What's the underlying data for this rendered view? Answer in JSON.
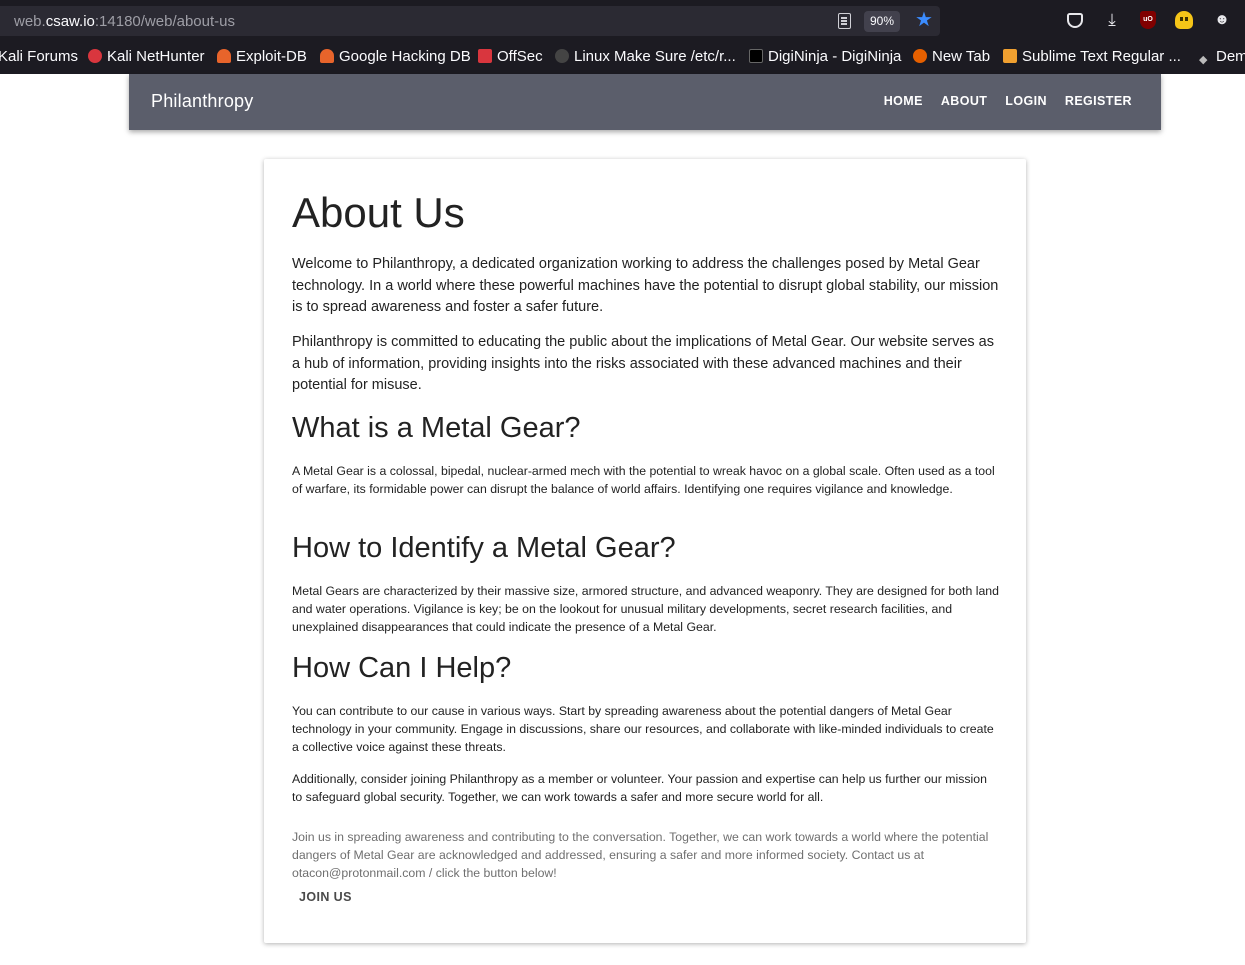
{
  "browser": {
    "url_prefix": "web.",
    "url_host": "csaw.io",
    "url_path": ":14180/web/about-us",
    "zoom": "90%",
    "bookmarks": [
      {
        "label": "Kali Forums",
        "color": "#2f6fd1"
      },
      {
        "label": "Kali NetHunter",
        "color": "#d9363e"
      },
      {
        "label": "Exploit-DB",
        "color": "#e8642b"
      },
      {
        "label": "Google Hacking DB",
        "color": "#e8642b"
      },
      {
        "label": "OffSec",
        "color": "#d9363e"
      },
      {
        "label": "Linux Make Sure /etc/r...",
        "color": "#444444"
      },
      {
        "label": "DigiNinja - DigiNinja",
        "color": "#000000"
      },
      {
        "label": "New Tab",
        "color": "#e66000"
      },
      {
        "label": "Sublime Text Regular ...",
        "color": "#f0a030"
      },
      {
        "label": "Dem",
        "color": "#bbbbbb"
      }
    ]
  },
  "navbar": {
    "brand": "Philanthropy",
    "links": [
      "HOME",
      "ABOUT",
      "LOGIN",
      "REGISTER"
    ]
  },
  "content": {
    "title": "About Us",
    "intro1": "Welcome to Philanthropy, a dedicated organization working to address the challenges posed by Metal Gear technology. In a world where these powerful machines have the potential to disrupt global stability, our mission is to spread awareness and foster a safer future.",
    "intro2": "Philanthropy is committed to educating the public about the implications of Metal Gear. Our website serves as a hub of information, providing insights into the risks associated with these advanced machines and their potential for misuse.",
    "h_what": "What is a Metal Gear?",
    "p_what": "A Metal Gear is a colossal, bipedal, nuclear-armed mech with the potential to wreak havoc on a global scale. Often used as a tool of warfare, its formidable power can disrupt the balance of world affairs. Identifying one requires vigilance and knowledge.",
    "h_identify": "How to Identify a Metal Gear?",
    "p_identify": "Metal Gears are characterized by their massive size, armored structure, and advanced weaponry. They are designed for both land and water operations. Vigilance is key; be on the lookout for unusual military developments, secret research facilities, and unexplained disappearances that could indicate the presence of a Metal Gear.",
    "h_help": "How Can I Help?",
    "p_help1": "You can contribute to our cause in various ways. Start by spreading awareness about the potential dangers of Metal Gear technology in your community. Engage in discussions, share our resources, and collaborate with like-minded individuals to create a collective voice against these threats.",
    "p_help2": "Additionally, consider joining Philanthropy as a member or volunteer. Your passion and expertise can help us further our mission to safeguard global security. Together, we can work towards a safer and more secure world for all.",
    "p_join": "Join us in spreading awareness and contributing to the conversation. Together, we can work towards a world where the potential dangers of Metal Gear are acknowledged and addressed, ensuring a safer and more informed society. Contact us at otacon@protonmail.com / click the button below!",
    "join_button": "JOIN US"
  }
}
